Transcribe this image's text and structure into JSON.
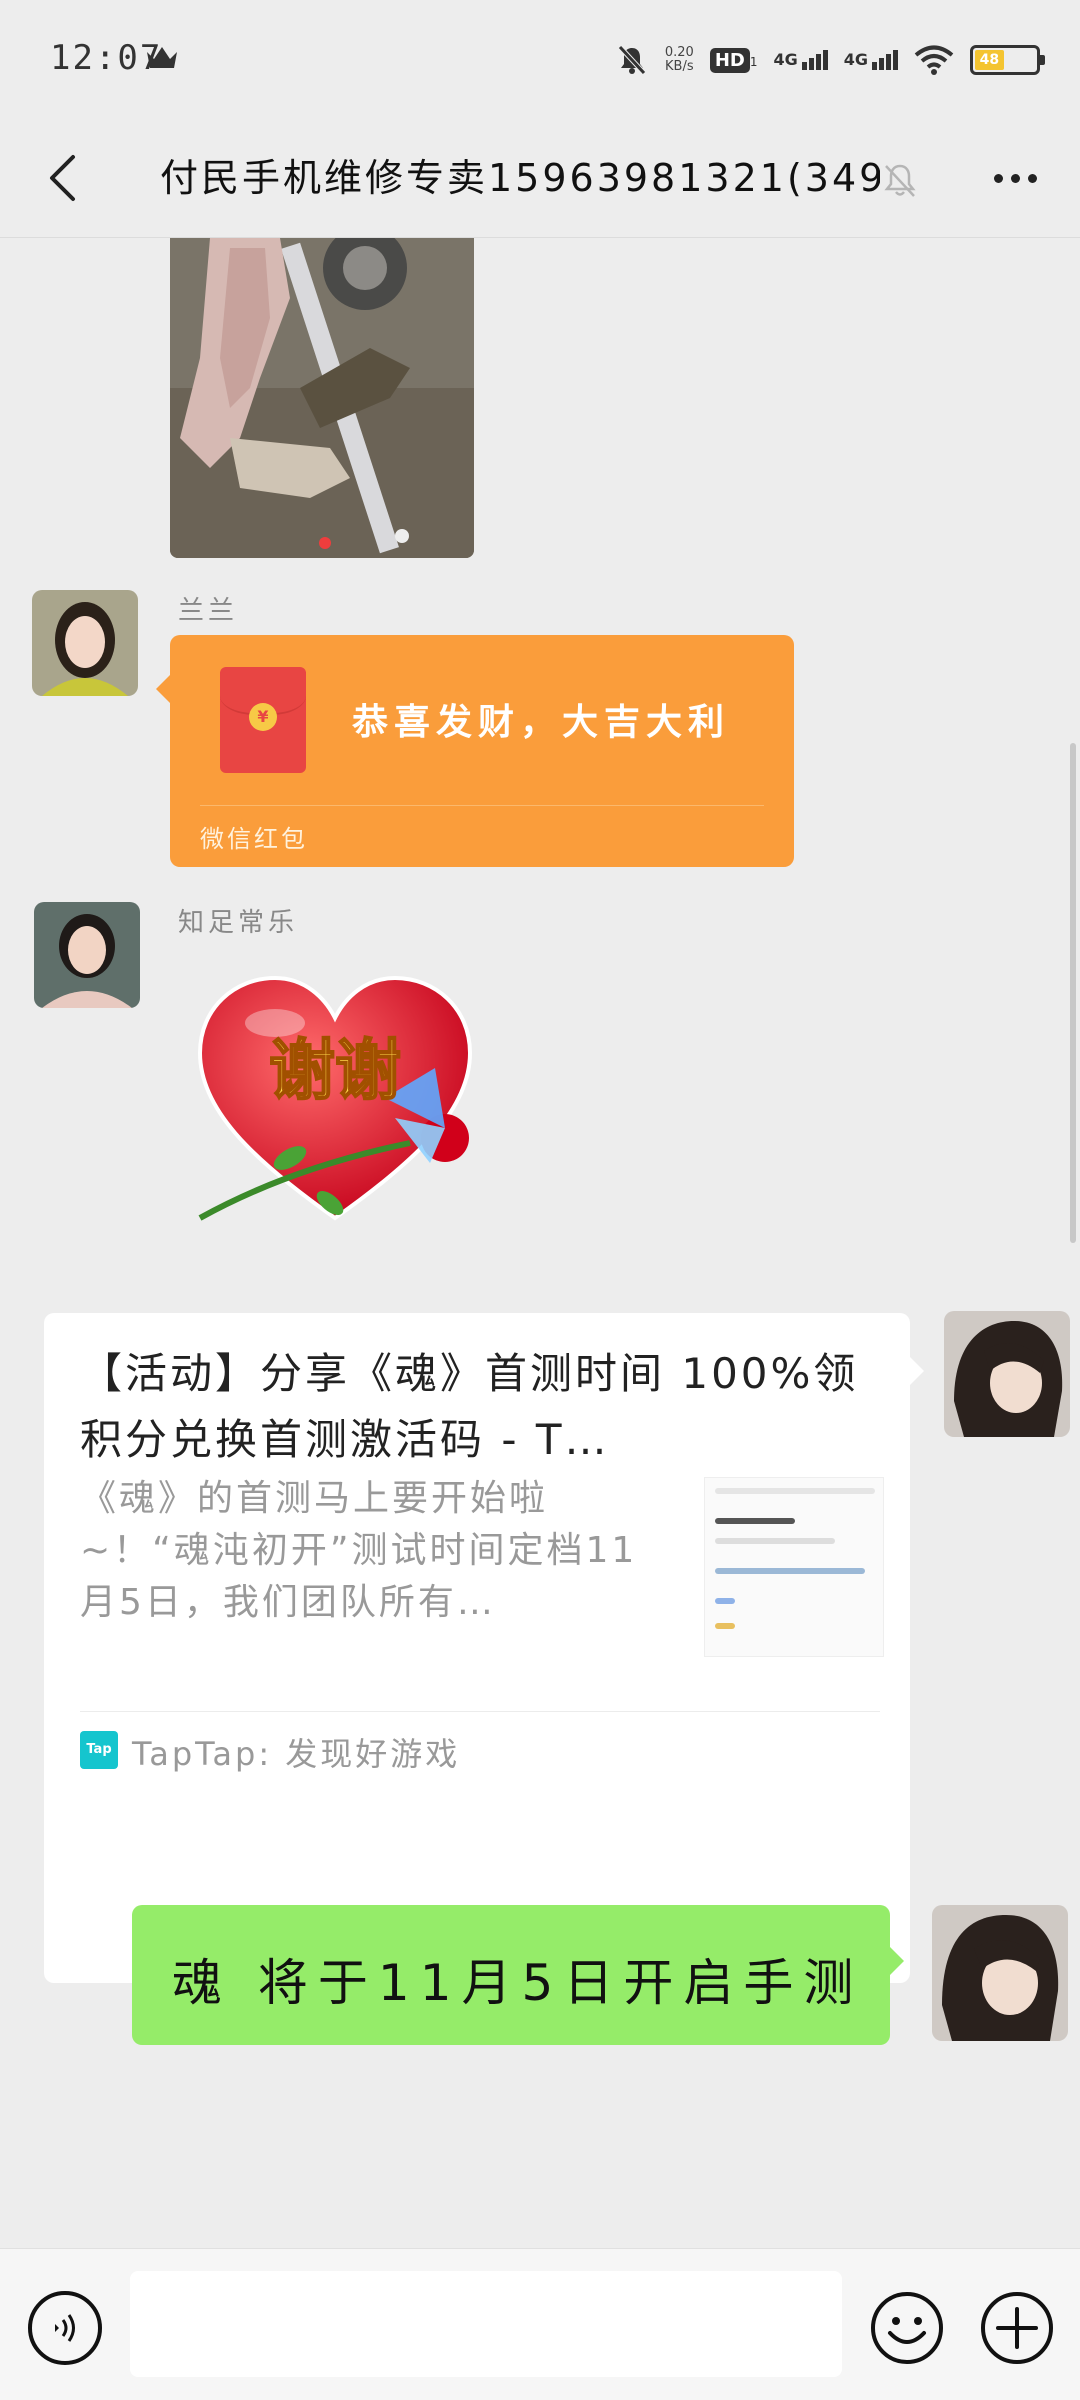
{
  "status_bar": {
    "time": "12:07",
    "network_speed_value": "0.20",
    "network_speed_unit": "KB/s",
    "hd_label": "HD",
    "hd_sub": "1",
    "net1_label": "4G",
    "net2_label": "4G",
    "battery_level": "48",
    "battery_color": "#f4c430"
  },
  "header": {
    "title": "付民手机维修专卖15963981321(349)",
    "back_icon": "chevron-left-icon",
    "mute_icon": "bell-muted-icon",
    "more_icon": "more-dots-icon"
  },
  "messages": {
    "red_packet": {
      "sender": "兰兰",
      "greeting": "恭喜发财，大吉大利",
      "label": "微信红包",
      "color": "#fa9d3b"
    },
    "sticker": {
      "sender": "知足常乐",
      "text": "谢谢"
    },
    "link_card": {
      "title": "【活动】分享《魂》首测时间 100%领积分兑换首测激活码 - T…",
      "description": "《魂》的首测马上要开始啦~！“魂沌初开”测试时间定档11月5日，我们团队所有…",
      "source_icon_text": "Tap",
      "source": "TapTap: 发现好游戏"
    },
    "text_message": {
      "text": "魂 将于11月5日开启手测",
      "bubble_color": "#95ec69"
    }
  },
  "input_bar": {
    "text_value": "",
    "voice_icon": "voice-icon",
    "emoji_icon": "emoji-icon",
    "plus_icon": "plus-icon"
  }
}
